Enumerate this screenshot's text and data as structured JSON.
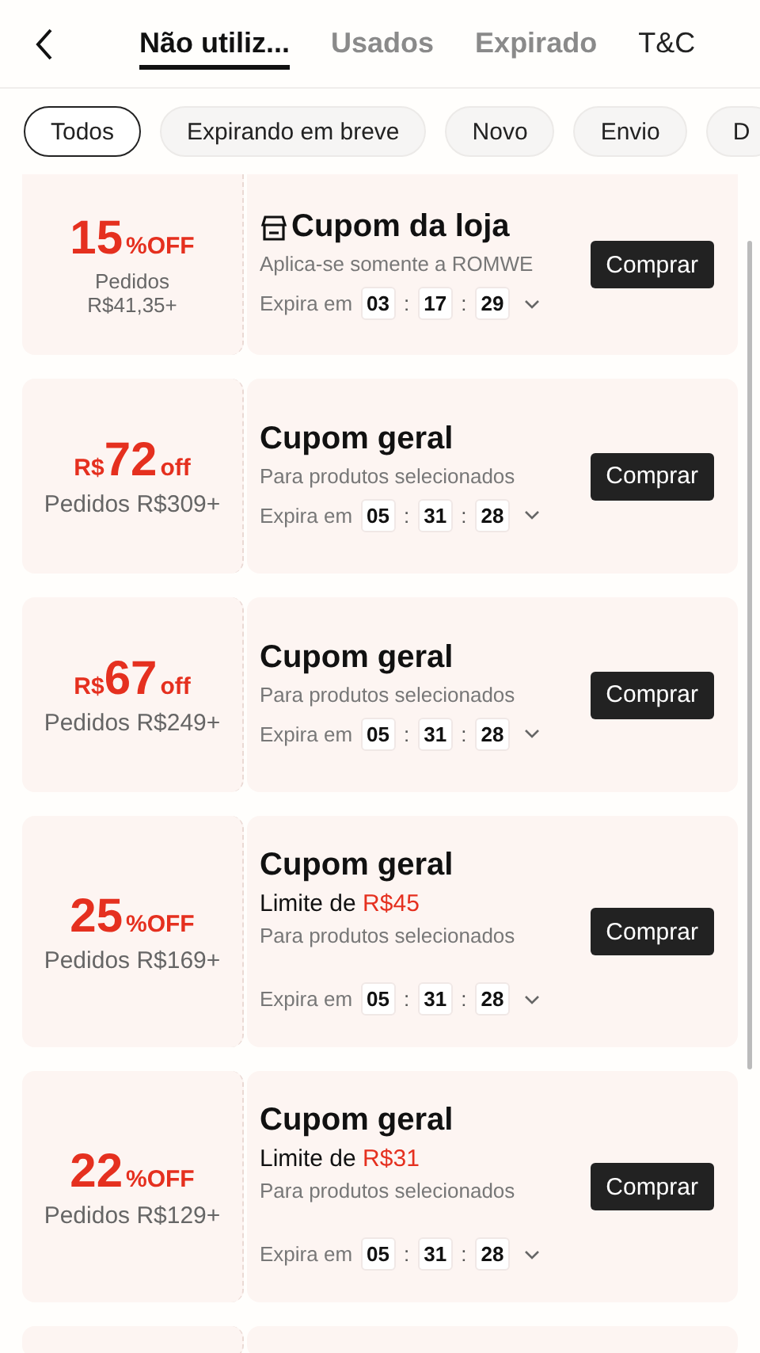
{
  "header": {
    "tabs": [
      {
        "label": "Não utiliz...",
        "selected": true
      },
      {
        "label": "Usados",
        "selected": false
      },
      {
        "label": "Expirado",
        "selected": false
      },
      {
        "label": "T&C",
        "selected": false
      }
    ]
  },
  "filters": [
    {
      "label": "Todos",
      "selected": true
    },
    {
      "label": "Expirando em breve",
      "selected": false
    },
    {
      "label": "Novo",
      "selected": false
    },
    {
      "label": "Envio",
      "selected": false
    },
    {
      "label": "D",
      "selected": false
    }
  ],
  "coupons": [
    {
      "kind": "store",
      "amount": "15",
      "suffix": "%OFF",
      "condition": "Pedidos R$41,35+",
      "title": "Cupom da loja",
      "note": "Aplica-se somente a ROMWE",
      "expires_label": "Expira em",
      "timer": [
        "03",
        ":",
        "17",
        ":",
        "29"
      ],
      "button": "Comprar"
    },
    {
      "kind": "general",
      "prefix": "R$",
      "amount": "72",
      "suffix": "off",
      "condition": "Pedidos R$309+",
      "title": "Cupom geral",
      "note": "Para produtos selecionados",
      "expires_label": "Expira em",
      "timer": [
        "05",
        ":",
        "31",
        ":",
        "28"
      ],
      "button": "Comprar"
    },
    {
      "kind": "general",
      "prefix": "R$",
      "amount": "67",
      "suffix": "off",
      "condition": "Pedidos R$249+",
      "title": "Cupom geral",
      "note": "Para produtos selecionados",
      "expires_label": "Expira em",
      "timer": [
        "05",
        ":",
        "31",
        ":",
        "28"
      ],
      "button": "Comprar"
    },
    {
      "kind": "general",
      "amount": "25",
      "suffix": "%OFF",
      "condition": "Pedidos R$169+",
      "title": "Cupom geral",
      "limit_label": "Limite de",
      "limit_value": "R$45",
      "note": "Para produtos selecionados",
      "expires_label": "Expira em",
      "timer": [
        "05",
        ":",
        "31",
        ":",
        "28"
      ],
      "button": "Comprar"
    },
    {
      "kind": "general",
      "amount": "22",
      "suffix": "%OFF",
      "condition": "Pedidos R$129+",
      "title": "Cupom geral",
      "limit_label": "Limite de",
      "limit_value": "R$31",
      "note": "Para produtos selecionados",
      "expires_label": "Expira em",
      "timer": [
        "05",
        ":",
        "31",
        ":",
        "28"
      ],
      "button": "Comprar"
    },
    {
      "kind": "empty"
    }
  ]
}
